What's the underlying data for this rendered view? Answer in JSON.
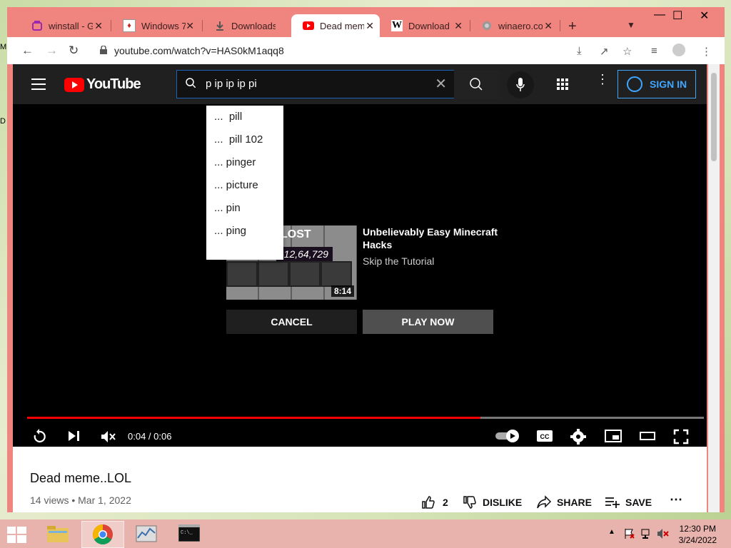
{
  "browser": {
    "tabs": [
      {
        "label": "winstall - G",
        "icon": "winstall-icon",
        "color": "#9c27b0"
      },
      {
        "label": "Windows 7",
        "icon": "cards-icon",
        "color": "#c62828"
      },
      {
        "label": "Downloads",
        "icon": "download-icon",
        "color": "#555555"
      },
      {
        "label": "Dead meme",
        "icon": "youtube-icon",
        "color": "#ff0000",
        "active": true
      },
      {
        "label": "Download",
        "icon": "w-icon",
        "color": "#000000"
      },
      {
        "label": "winaero.co",
        "icon": "globe-icon",
        "color": "#888888"
      }
    ],
    "url": "youtube.com/watch?v=HAS0kM1aqq8"
  },
  "youtube": {
    "logo_text": "YouTube",
    "search_value": "p ip ip ip pi",
    "signin_label": "SIGN IN",
    "suggestions": [
      "...  pill",
      "...  pill 102",
      "... pinger",
      "... picture",
      "... pin",
      "... ping"
    ],
    "endscreen": {
      "title": "Unbelievably Easy Minecraft Hacks",
      "subtitle": "Skip the Tutorial",
      "duration": "8:14",
      "thumb_text": "LOST",
      "thumb_counter": "-12,64,729",
      "cancel_label": "CANCEL",
      "play_label": "PLAY NOW"
    },
    "player": {
      "time": "0:04 / 0:06",
      "progress": 0.67,
      "accent": "#ff0000"
    },
    "video": {
      "title": "Dead meme..LOL",
      "meta": "14 views • Mar 1, 2022",
      "likes": "2",
      "dislike_label": "DISLIKE",
      "share_label": "SHARE",
      "save_label": "SAVE"
    }
  },
  "taskbar": {
    "time": "12:30 PM",
    "date": "3/24/2022"
  },
  "desktop": {
    "edge_letters": [
      "M",
      "D"
    ]
  }
}
